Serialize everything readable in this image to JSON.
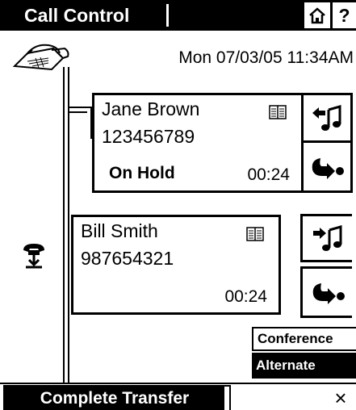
{
  "header": {
    "title": "Call Control",
    "home_icon": "home-icon",
    "help_label": "?"
  },
  "datetime": "Mon 07/03/05 11:34AM",
  "calls": [
    {
      "name": "Jane Brown",
      "number": "123456789",
      "status": "On Hold",
      "timer": "00:24",
      "icon": "phonebook-icon"
    },
    {
      "name": "Bill Smith",
      "number": "987654321",
      "status": "",
      "timer": "00:24",
      "icon": "phonebook-icon"
    }
  ],
  "controls": {
    "call1": [
      "retrieve-music-icon",
      "transfer-arrow-icon"
    ],
    "call2": [
      "hold-music-icon",
      "transfer-arrow-icon"
    ]
  },
  "menu": {
    "conference": "Conference",
    "alternate": "Alternate"
  },
  "footer": {
    "complete_transfer": "Complete Transfer",
    "close": "×"
  }
}
